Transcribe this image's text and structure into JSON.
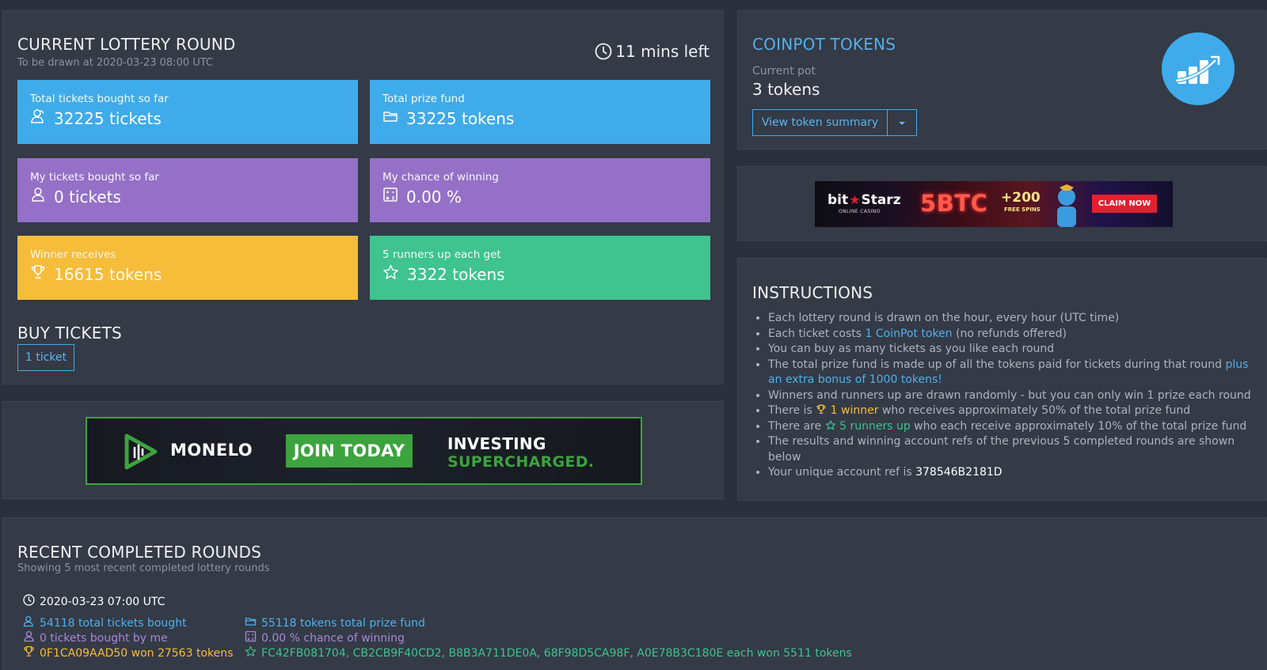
{
  "current_round": {
    "title": "CURRENT LOTTERY ROUND",
    "subtitle": "To be drawn at 2020-03-23 08:00 UTC",
    "time_left": "11 mins left",
    "tiles": {
      "total_tickets": {
        "label": "Total tickets bought so far",
        "value": "32225 tickets"
      },
      "prize_fund": {
        "label": "Total prize fund",
        "value": "33225 tokens"
      },
      "my_tickets": {
        "label": "My tickets bought so far",
        "value": "0 tickets"
      },
      "my_chance": {
        "label": "My chance of winning",
        "value": "0.00 %"
      },
      "winner": {
        "label": "Winner receives",
        "value": "16615 tokens"
      },
      "runners_up": {
        "label": "5 runners up each get",
        "value": "3322 tokens"
      }
    }
  },
  "buy": {
    "title": "BUY TICKETS",
    "button": "1 ticket"
  },
  "banner_left": {
    "brand": "MONELO",
    "cta": "JOIN TODAY",
    "line1": "INVESTING",
    "line2": "SUPERCHARGED."
  },
  "coinpot": {
    "title": "COINPOT TOKENS",
    "pot_label": "Current pot",
    "pot_value": "3 tokens",
    "button": "View token summary"
  },
  "banner_right": {
    "brand": "bit",
    "brand2": "Starz",
    "brand_sub": "ONLINE CASINO",
    "offer": "5BTC",
    "bonus": "+200",
    "bonus_sub": "FREE SPINS",
    "cta": "CLAIM NOW"
  },
  "instructions": {
    "title": "INSTRUCTIONS",
    "i1": "Each lottery round is drawn on the hour, every hour (UTC time)",
    "i2_pre": "Each ticket costs ",
    "i2_link": "1 CoinPot token",
    "i2_post": " (no refunds offered)",
    "i3": "You can buy as many tickets as you like each round",
    "i4_pre": "The total prize fund is made up of all the tokens paid for tickets during that round ",
    "i4_link": "plus an extra bonus of 1000 tokens!",
    "i5": "Winners and runners up are drawn randomly - but you can only win 1 prize each round",
    "i6_pre": "There is ",
    "i6_hl": "1 winner",
    "i6_post": " who receives approximately 50% of the total prize fund",
    "i7_pre": "There are ",
    "i7_hl": "5 runners up",
    "i7_post": " who each receive approximately 10% of the total prize fund",
    "i8": "The results and winning account refs of the previous 5 completed rounds are shown below",
    "i9_pre": "Your unique account ref is ",
    "i9_ref": "378546B2181D"
  },
  "recent": {
    "title": "RECENT COMPLETED ROUNDS",
    "subtitle": "Showing 5 most recent completed lottery rounds",
    "round1": {
      "time": "2020-03-23 07:00 UTC",
      "total_tickets": "54118 total tickets bought",
      "prize_fund": "55118 tokens total prize fund",
      "my_tickets": "0 tickets bought by me",
      "my_chance": "0.00 % chance of winning",
      "winner": "0F1CA09AAD50 won 27563 tokens",
      "runners_up": "FC42FB081704, CB2CB9F40CD2, B8B3A711DE0A, 68F98D5CA98F, A0E78B3C180E each won 5511 tokens"
    }
  },
  "colors": {
    "background": "#2b313c",
    "panel": "#343a46",
    "blue": "#3fabea",
    "purple": "#9470c7",
    "yellow": "#f6bd3b",
    "green": "#3fc38f"
  }
}
